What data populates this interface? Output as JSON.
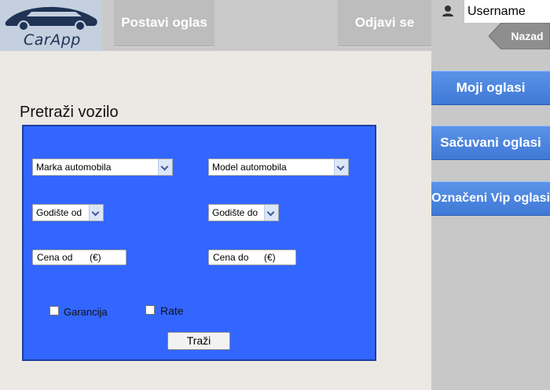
{
  "header": {
    "logo_text": "CarApp",
    "post_ad_label": "Postavi oglas",
    "logout_label": "Odjavi se"
  },
  "user": {
    "icon": "user-icon",
    "username": "Username",
    "back_label": "Nazad"
  },
  "sidebar": {
    "items": [
      {
        "label": "Moji oglasi"
      },
      {
        "label": "Sačuvani oglasi"
      },
      {
        "label": "Označeni Vip oglasi"
      }
    ]
  },
  "search": {
    "title": "Pretraži vozilo",
    "brand_select": "Marka automobila",
    "model_select": "Model automobila",
    "year_from": "Godište od",
    "year_to": "Godište do",
    "price_from": "Cena od",
    "price_to": "Cena do",
    "currency": "(€)",
    "warranty_label": "Garancija",
    "installments_label": "Rate",
    "submit_label": "Traži"
  },
  "colors": {
    "panel": "#3366ff",
    "sidebar_button": "#4a86e0",
    "topbar": "#c9c9c9"
  }
}
